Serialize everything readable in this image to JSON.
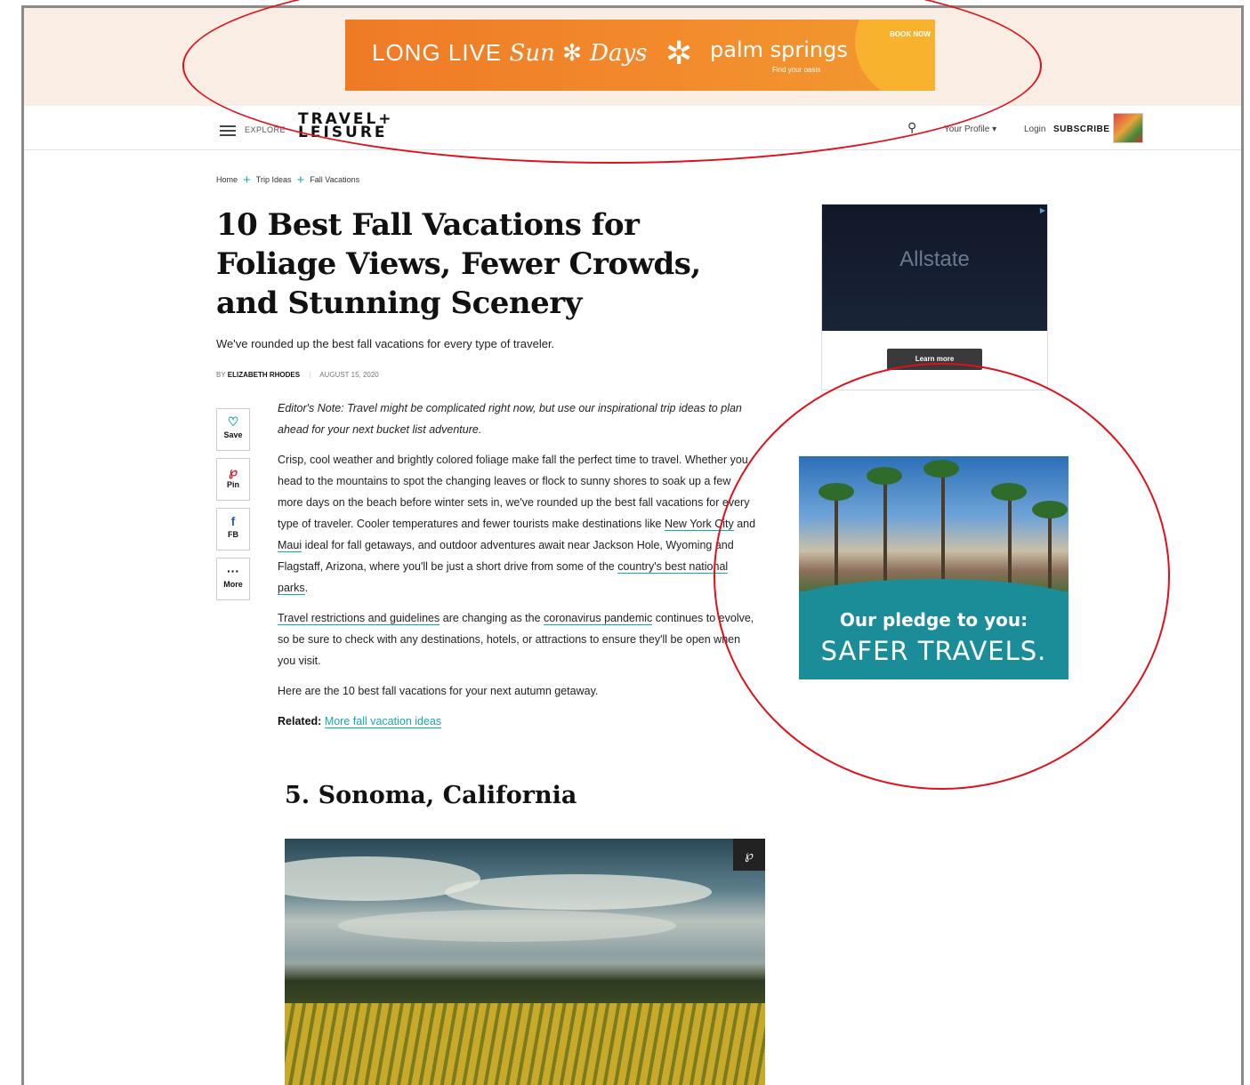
{
  "ad_banner": {
    "left_text": "LONG LIVE",
    "script_text": "Sun",
    "script_text2": "Days",
    "brand": "palm springs",
    "brand_sub": "Find your oasis",
    "cta": "BOOK NOW"
  },
  "header": {
    "explore": "EXPLORE",
    "logo_line1": "TRAVEL+",
    "logo_line2": "LEISURE",
    "profile": "Your Profile ▾",
    "login": "Login",
    "subscribe": "SUBSCRIBE"
  },
  "breadcrumb": {
    "items": [
      "Home",
      "Trip Ideas",
      "Fall Vacations"
    ]
  },
  "article": {
    "title": "10 Best Fall Vacations for Foliage Views, Fewer Crowds, and Stunning Scenery",
    "dek": "We've rounded up the best fall vacations for every type of traveler.",
    "author_prefix": "BY",
    "author": "ELIZABETH RHODES",
    "date": "AUGUST 15, 2020",
    "editors_note": "Editor's Note: Travel might be complicated right now, but use our inspirational trip ideas to plan ahead for your next bucket list adventure.",
    "p1_a": "Crisp, cool weather and brightly colored foliage make fall the perfect time to travel. Whether you head to the mountains to spot the changing leaves or flock to sunny shores to soak up a few more days on the beach before winter sets in, we've rounded up the best fall vacations for every type of traveler. Cooler temperatures and fewer tourists make destinations like ",
    "p1_link1": "New York City",
    "p1_b": " and ",
    "p1_link2": "Maui",
    "p1_c": " ideal for fall getaways, and outdoor adventures await near Jackson Hole, Wyoming and Flagstaff, Arizona, where you'll be just a short drive from some of the ",
    "p1_link3": "country's best national parks",
    "p1_d": ".",
    "p2_link1": "Travel restrictions and guidelines",
    "p2_a": " are changing as the ",
    "p2_link2": "coronavirus pandemic",
    "p2_b": " continues to evolve, so be sure to check with any destinations, hotels, or attractions to ensure they'll be open when you visit.",
    "p3": "Here are the 10 best fall vacations for your next autumn getaway.",
    "related_label": "Related:",
    "related_link": "More fall vacation ideas",
    "subhead": "5. Sonoma, California"
  },
  "share": {
    "save": "Save",
    "pin": "Pin",
    "fb": "FB",
    "more": "More"
  },
  "ad_allstate": {
    "brand": "Allstate",
    "cta": "Learn more"
  },
  "ad_safer": {
    "line1": "Our pledge to you:",
    "line2": "SAFER TRAVELS."
  },
  "colors": {
    "accent": "#17a8a6",
    "annotation": "#e0101a",
    "banner": "#f28a2c"
  }
}
